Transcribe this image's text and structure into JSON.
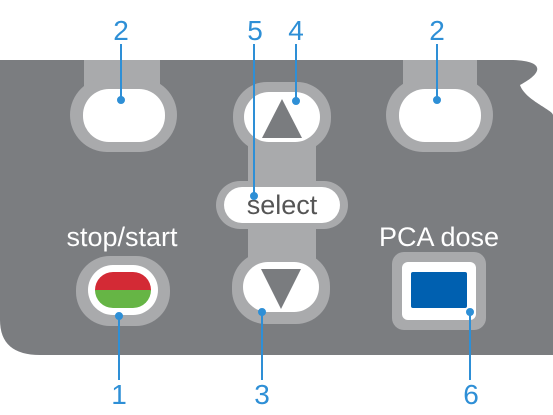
{
  "panel": {
    "labels": {
      "stop_start": "stop/start",
      "pca_dose": "PCA dose",
      "select": "select"
    }
  },
  "callouts": {
    "left_softkey": "2",
    "right_softkey": "2",
    "up": "4",
    "select": "5",
    "down": "3",
    "stop_start": "1",
    "pca_dose": "6"
  },
  "colors": {
    "panel": "#7b7d80",
    "button_ring": "#a9aaac",
    "button_face": "#ffffff",
    "arrow": "#7a7c7f",
    "callout_text": "#2e8fd6",
    "stop_red": "#d32a35",
    "start_green": "#66b545",
    "pca_blue": "#0060b0"
  }
}
